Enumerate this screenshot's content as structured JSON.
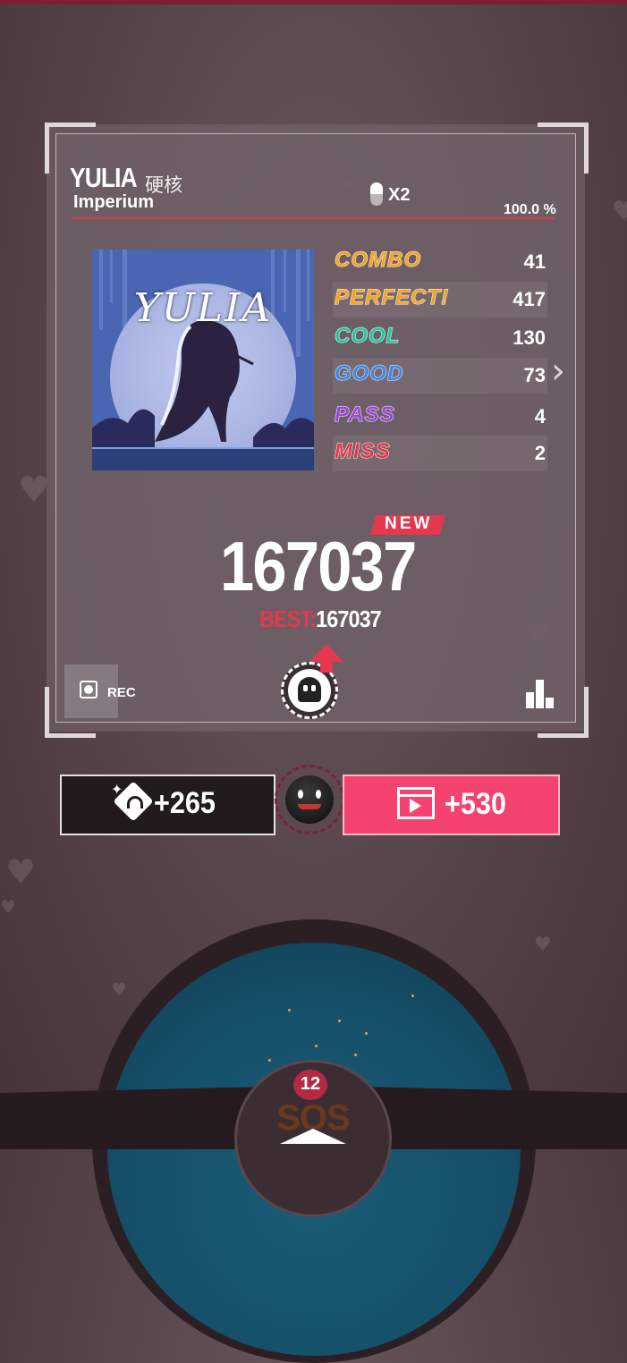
{
  "song": {
    "title": "YULIA",
    "difficulty": "硬核",
    "artist": "Imperium",
    "multiplier": "X2",
    "accuracy": "100.0 %"
  },
  "album": {
    "title": "YULIA"
  },
  "judgements": [
    {
      "label": "COMBO",
      "value": "41",
      "color": "#f6a225"
    },
    {
      "label": "PERFECT!",
      "value": "417",
      "color": "#f6a225"
    },
    {
      "label": "COOL",
      "value": "130",
      "color": "#25c8a0"
    },
    {
      "label": "GOOD",
      "value": "73",
      "color": "#3c86e6"
    },
    {
      "label": "PASS",
      "value": "4",
      "color": "#9a47d8"
    },
    {
      "label": "MISS",
      "value": "2",
      "color": "#e2384c"
    }
  ],
  "result": {
    "new_badge": "NEW",
    "score": "167037",
    "best_label": "BEST:",
    "best_value": "167037"
  },
  "controls": {
    "rec_label": "REC"
  },
  "rewards": {
    "left_value": "+265",
    "right_value": "+530"
  },
  "dial": {
    "count": "12",
    "label": "SOS"
  },
  "colors": {
    "accent": "#e3384f",
    "reward_pink": "#f4436f",
    "dial_blue": "#1a5c78"
  }
}
